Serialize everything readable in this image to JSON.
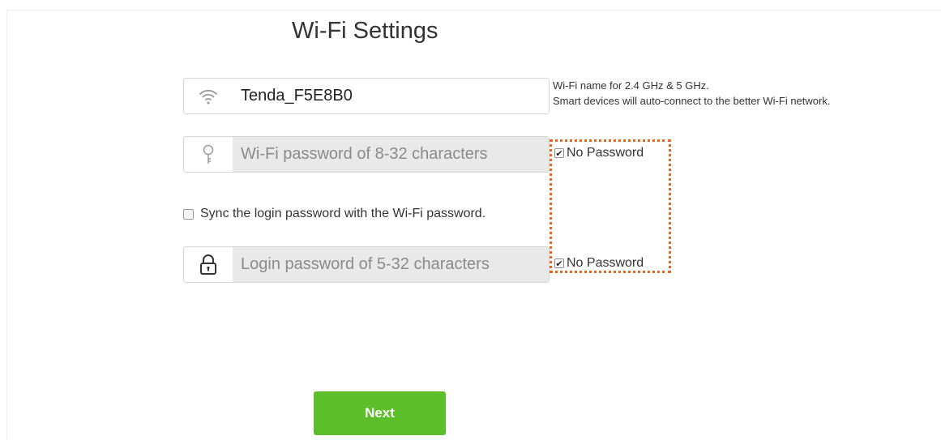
{
  "page": {
    "title": "Wi-Fi Settings"
  },
  "wifi_name": {
    "value": "Tenda_F5E8B0",
    "icon": "wifi-icon",
    "hint_line1": "Wi-Fi name for 2.4 GHz & 5 GHz.",
    "hint_line2": "Smart devices will auto-connect to the better Wi-Fi network."
  },
  "wifi_password": {
    "placeholder": "Wi-Fi password of 8-32 characters",
    "icon": "key-icon",
    "no_password_label": "No Password",
    "no_password_checked": true
  },
  "sync": {
    "label": "Sync the login password with the Wi-Fi password.",
    "checked": false
  },
  "login_password": {
    "placeholder": "Login password of 5-32 characters",
    "icon": "lock-icon",
    "no_password_label": "No Password",
    "no_password_checked": true
  },
  "actions": {
    "next_label": "Next"
  },
  "colors": {
    "accent": "#5cbf2a",
    "highlight": "#e8651e"
  }
}
